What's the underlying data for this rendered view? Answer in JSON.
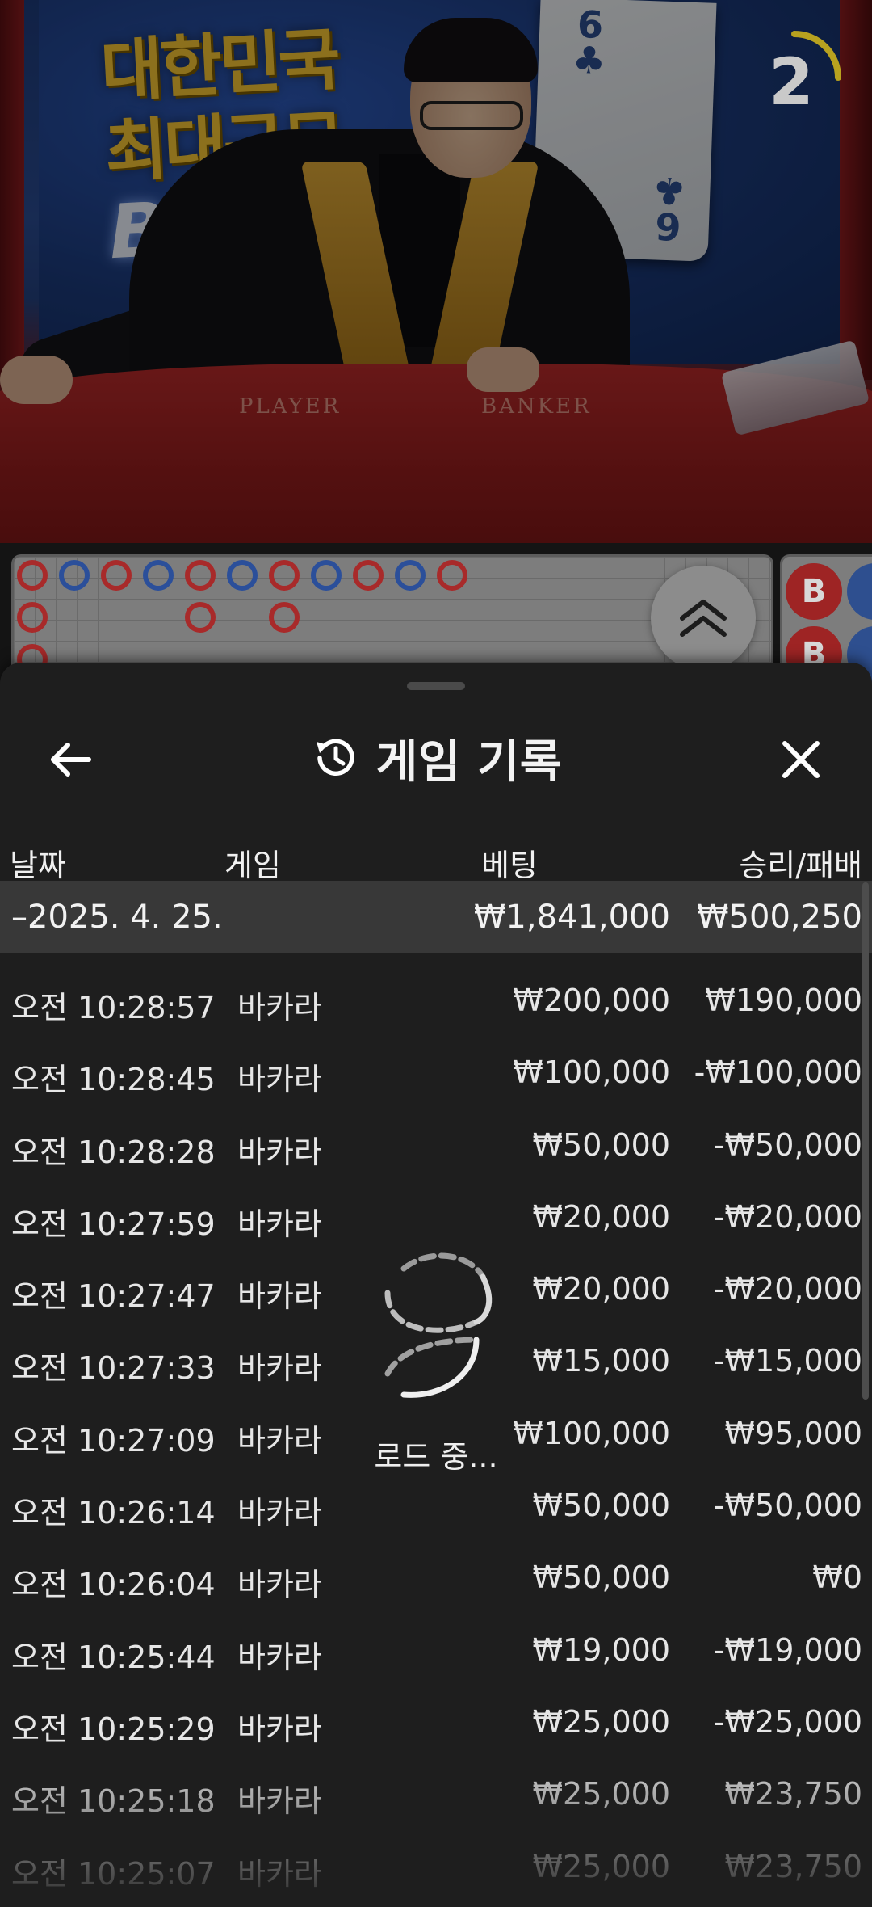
{
  "video": {
    "timer": "2",
    "sign_line1": "대한민국",
    "sign_line2": "최대규모",
    "sign_line3": "BET",
    "table_player": "PLAYER",
    "table_banker": "BANKER"
  },
  "beads": [
    "B",
    "B"
  ],
  "history": {
    "title": "게임 기록",
    "columns": {
      "date": "날짜",
      "game": "게임",
      "bet": "베팅",
      "result": "승리/패배"
    },
    "day": {
      "date": "–2025. 4. 25.",
      "bet": "₩1,841,000",
      "result": "₩500,250"
    },
    "rows": [
      {
        "time": "오전 10:28:57",
        "game": "바카라",
        "bet": "₩200,000",
        "result": "₩190,000"
      },
      {
        "time": "오전 10:28:45",
        "game": "바카라",
        "bet": "₩100,000",
        "result": "-₩100,000"
      },
      {
        "time": "오전 10:28:28",
        "game": "바카라",
        "bet": "₩50,000",
        "result": "-₩50,000"
      },
      {
        "time": "오전 10:27:59",
        "game": "바카라",
        "bet": "₩20,000",
        "result": "-₩20,000"
      },
      {
        "time": "오전 10:27:47",
        "game": "바카라",
        "bet": "₩20,000",
        "result": "-₩20,000"
      },
      {
        "time": "오전 10:27:33",
        "game": "바카라",
        "bet": "₩15,000",
        "result": "-₩15,000"
      },
      {
        "time": "오전 10:27:09",
        "game": "바카라",
        "bet": "₩100,000",
        "result": "₩95,000"
      },
      {
        "time": "오전 10:26:14",
        "game": "바카라",
        "bet": "₩50,000",
        "result": "-₩50,000"
      },
      {
        "time": "오전 10:26:04",
        "game": "바카라",
        "bet": "₩50,000",
        "result": "₩0"
      },
      {
        "time": "오전 10:25:44",
        "game": "바카라",
        "bet": "₩19,000",
        "result": "-₩19,000"
      },
      {
        "time": "오전 10:25:29",
        "game": "바카라",
        "bet": "₩25,000",
        "result": "-₩25,000"
      },
      {
        "time": "오전 10:25:18",
        "game": "바카라",
        "bet": "₩25,000",
        "result": "₩23,750"
      },
      {
        "time": "오전 10:25:07",
        "game": "바카라",
        "bet": "₩25,000",
        "result": "₩23,750"
      }
    ],
    "loading": "로드 중..."
  }
}
